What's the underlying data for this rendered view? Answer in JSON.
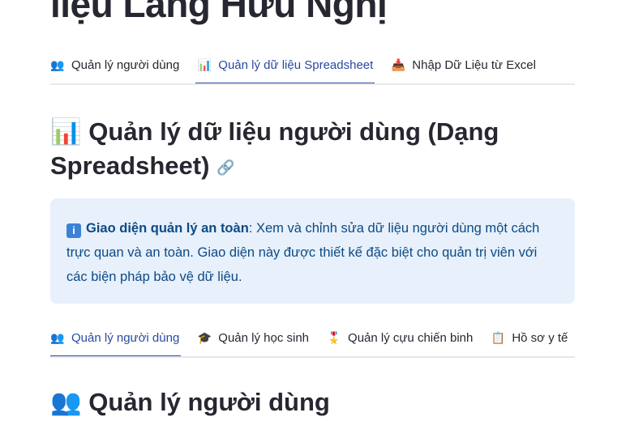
{
  "page_title": "liệu Làng Hữu Nghị",
  "main_tabs": [
    {
      "icon": "users-icon",
      "glyph": "👥",
      "label": "Quản lý người dùng"
    },
    {
      "icon": "bar-chart-icon",
      "glyph": "📊",
      "label": "Quản lý dữ liệu Spreadsheet",
      "active": true
    },
    {
      "icon": "inbox-tray-icon",
      "glyph": "📥",
      "label": "Nhập Dữ Liệu từ Excel"
    }
  ],
  "section": {
    "icon_glyph": "📊",
    "title": "Quản lý dữ liệu người dùng (Dạng Spreadsheet)",
    "link_glyph": "🔗"
  },
  "info": {
    "icon_glyph": "i",
    "bold": "Giao diện quản lý an toàn",
    "text": ": Xem và chỉnh sửa dữ liệu người dùng một cách trực quan và an toàn. Giao diện này được thiết kế đặc biệt cho quản trị viên với các biện pháp bảo vệ dữ liệu."
  },
  "sub_tabs": [
    {
      "icon": "users-icon",
      "glyph": "👥",
      "label": "Quản lý người dùng",
      "active": true
    },
    {
      "icon": "graduation-cap-icon",
      "glyph": "🎓",
      "label": "Quản lý học sinh"
    },
    {
      "icon": "medal-icon",
      "glyph": "🎖️",
      "label": "Quản lý cựu chiến binh"
    },
    {
      "icon": "record-icon",
      "glyph": "📋",
      "label": "Hồ sơ y tế"
    }
  ],
  "subsection": {
    "icon_glyph": "👥",
    "title": "Quản lý người dùng"
  },
  "colors": {
    "accent": "#2a4aa0",
    "info_bg": "#e7f0fb",
    "info_text": "#0c4a86"
  }
}
